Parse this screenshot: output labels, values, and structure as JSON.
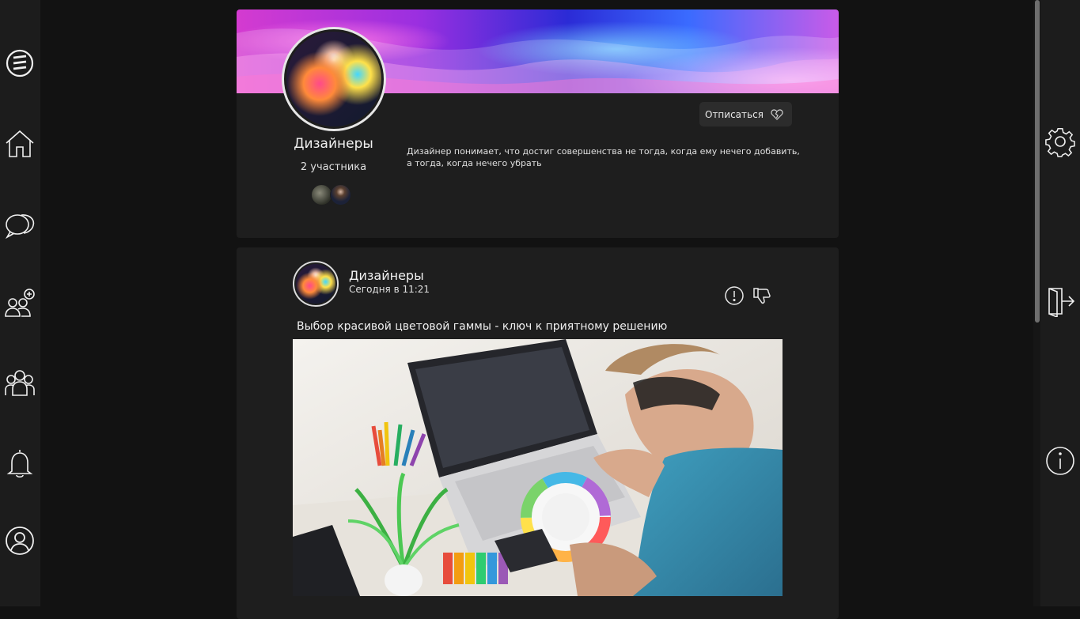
{
  "nav_left": [
    {
      "name": "logo-icon"
    },
    {
      "name": "home-icon"
    },
    {
      "name": "chat-icon"
    },
    {
      "name": "add-friend-icon"
    },
    {
      "name": "groups-icon"
    },
    {
      "name": "bell-icon"
    },
    {
      "name": "profile-icon"
    }
  ],
  "nav_right": [
    {
      "name": "gear-icon"
    },
    {
      "name": "logout-icon"
    },
    {
      "name": "info-icon"
    }
  ],
  "group": {
    "name": "Дизайнеры",
    "members": "2 участника",
    "unsubscribe_label": "Отписаться",
    "description": "Дизайнер понимает, что достиг совершенства не тогда, когда ему нечего добавить, а тогда, когда нечего убрать"
  },
  "post": {
    "author": "Дизайнеры",
    "time": "Сегодня в 11:21",
    "text": "Выбор красивой цветовой гаммы - ключ к приятному решению"
  },
  "colors": {
    "background": "#121212",
    "panel": "#1c1c1c",
    "card": "#1e1e1e",
    "button": "#2c2c2c"
  }
}
